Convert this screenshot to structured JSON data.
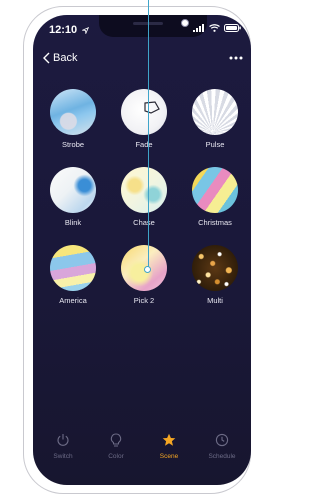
{
  "status_bar": {
    "time": "12:10"
  },
  "header": {
    "back_label": "Back"
  },
  "scenes": [
    {
      "label": "Strobe"
    },
    {
      "label": "Fade"
    },
    {
      "label": "Pulse"
    },
    {
      "label": "Blink"
    },
    {
      "label": "Chase"
    },
    {
      "label": "Christmas"
    },
    {
      "label": "America"
    },
    {
      "label": "Pick 2"
    },
    {
      "label": "Multi"
    }
  ],
  "tab_bar": {
    "tabs": [
      {
        "label": "Switch",
        "icon": "power-icon"
      },
      {
        "label": "Color",
        "icon": "bulb-icon"
      },
      {
        "label": "Scene",
        "icon": "star-icon",
        "active": true
      },
      {
        "label": "Schedule",
        "icon": "clock-icon"
      }
    ]
  },
  "colors": {
    "accent": "#f5a623",
    "background": "#1c1a3f",
    "guide": "#3fa4c9"
  }
}
